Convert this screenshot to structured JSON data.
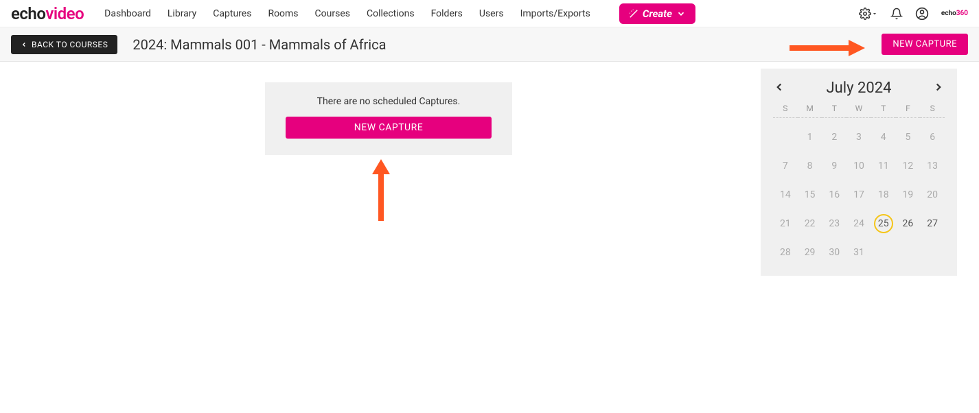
{
  "logo": {
    "part1": "echo",
    "part2": "video"
  },
  "nav": {
    "items": [
      "Dashboard",
      "Library",
      "Captures",
      "Rooms",
      "Courses",
      "Collections",
      "Folders",
      "Users",
      "Imports/Exports"
    ],
    "create_label": "Create"
  },
  "brand_small": {
    "part1": "echo",
    "part2": "360"
  },
  "subheader": {
    "back_label": "BACK TO COURSES",
    "course_title": "2024: Mammals 001 - Mammals of Africa",
    "new_capture_label": "NEW CAPTURE"
  },
  "center": {
    "empty_message": "There are no scheduled Captures.",
    "new_capture_label": "NEW CAPTURE"
  },
  "calendar": {
    "title": "July 2024",
    "dow": [
      "S",
      "M",
      "T",
      "W",
      "T",
      "F",
      "S"
    ],
    "leading_blanks": 1,
    "days": 31,
    "today": 25,
    "strong_days": [
      26,
      27
    ]
  }
}
